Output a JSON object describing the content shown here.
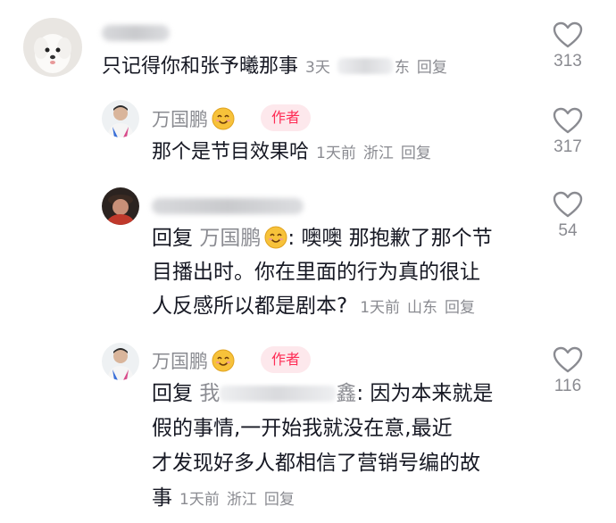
{
  "comments": [
    {
      "username": "",
      "text": "只记得你和张予曦那事",
      "meta": {
        "time": "3天",
        "location": "东",
        "reply": "回复"
      },
      "likes": "313"
    },
    {
      "username": "万国鹏",
      "author_tag": "作者",
      "text": "那个是节目效果哈",
      "meta": {
        "time": "1天前",
        "location": "浙江",
        "reply": "回复"
      },
      "likes": "317"
    },
    {
      "username": "",
      "reply_prefix": "回复",
      "reply_target": "万国鹏",
      "text_line1": ": 噢噢 那抱歉了那个节",
      "text_line2": "目播出时。你在里面的行为真的很让",
      "text_line3": "人反感所以都是剧本?",
      "meta": {
        "time": "1天前",
        "location": "山东",
        "reply": "回复"
      },
      "likes": "54"
    },
    {
      "username": "万国鹏",
      "author_tag": "作者",
      "reply_prefix": "回复",
      "reply_target_start": "我",
      "reply_target_end": "鑫",
      "text_line1": ": 因为本来就是",
      "text_line2": "假的事情,一开始我就没在意,最近",
      "text_line3": "才发现好多人都相信了营销号编的故",
      "text_line4": "事",
      "meta": {
        "time": "1天前",
        "location": "浙江",
        "reply": "回复"
      },
      "likes": "116"
    }
  ],
  "colors": {
    "accent": "#fe2c55",
    "tag_bg": "#fde8ec",
    "muted": "#8a8b91",
    "text": "#161823"
  }
}
